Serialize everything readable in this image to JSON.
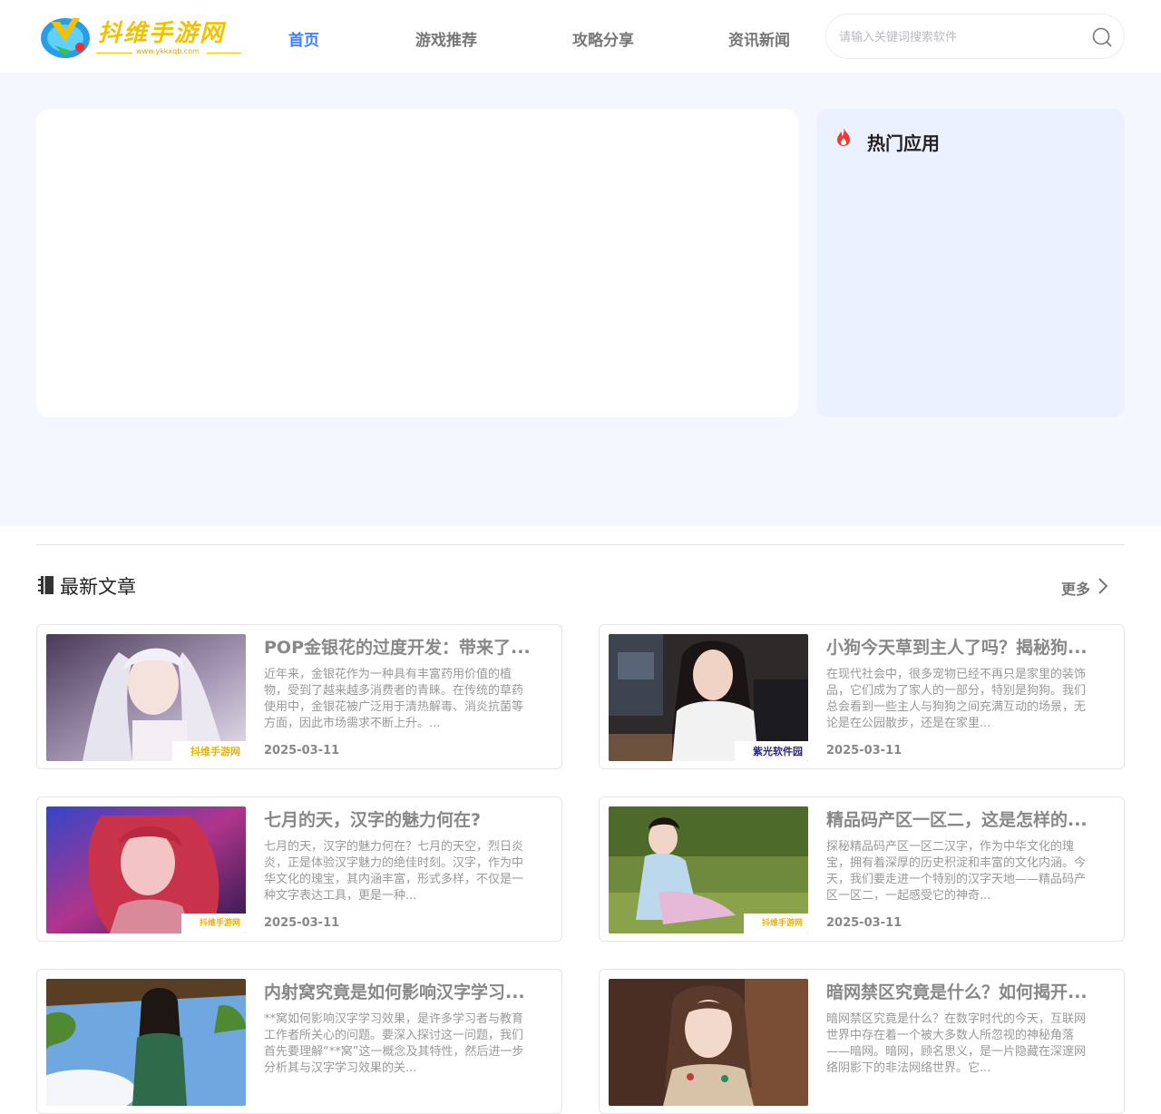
{
  "header": {
    "logo_text": "抖维手游网",
    "logo_url": "www.ykkxqb.com",
    "nav": [
      "首页",
      "游戏推荐",
      "攻略分享",
      "资讯新闻"
    ],
    "search_placeholder": "请输入关键词搜索软件"
  },
  "hot": {
    "title": "热门应用"
  },
  "latest": {
    "title": "最新文章",
    "more": "更多",
    "articles": [
      {
        "title": "POP金银花的过度开发：带来了...",
        "desc": "近年来，金银花作为一种具有丰富药用价值的植物，受到了越来越多消费者的青睐。在传统的草药使用中，金银花被广泛用于清热解毒、消炎抗菌等方面，因此市场需求不断上升。...",
        "date": "2025-03-11",
        "watermark": "抖维手游网"
      },
      {
        "title": "小狗今天草到主人了吗？揭秘狗...",
        "desc": "在现代社会中，很多宠物已经不再只是家里的装饰品，它们成为了家人的一部分，特别是狗狗。我们总会看到一些主人与狗狗之间充满互动的场景，无论是在公园散步，还是在家里...",
        "date": "2025-03-11",
        "watermark": "紫光软件园"
      },
      {
        "title": "七月的天，汉字的魅力何在?",
        "desc": "七月的天，汉字的魅力何在？七月的天空，烈日炎炎，正是体验汉字魅力的绝佳时刻。汉字，作为中华文化的瑰宝，其内涵丰富，形式多样，不仅是一种文字表达工具，更是一种...",
        "date": "2025-03-11",
        "watermark": "抖维手游网"
      },
      {
        "title": "精品码产区一区二，这是怎样的...",
        "desc": "探秘精品码产区一区二汉字，作为中华文化的瑰宝，拥有着深厚的历史积淀和丰富的文化内涵。今天，我们要走进一个特别的汉字天地——精品码产区一区二，一起感受它的神奇...",
        "date": "2025-03-11",
        "watermark": "抖维手游网"
      },
      {
        "title": "内射窝究竟是如何影响汉字学习...",
        "desc": "**窝如何影响汉字学习效果，是许多学习者与教育工作者所关心的问题。要深入探讨这一问题，我们首先要理解“**窝”这一概念及其特性，然后进一步分析其与汉字学习效果的关...",
        "date": "",
        "watermark": ""
      },
      {
        "title": "暗网禁区究竟是什么？如何揭开...",
        "desc": "暗网禁区究竟是什么？在数字时代的今天，互联网世界中存在着一个被大多数人所忽视的神秘角落——暗网。暗网，顾名思义，是一片隐藏在深邃网络阴影下的非法网络世界。它...",
        "date": "",
        "watermark": ""
      }
    ]
  },
  "colors": {
    "accent": "#3b82f6",
    "band_bg": "#f4f7fd",
    "hot_bg": "#ebf1fe",
    "logo_yellow": "#f2c200"
  },
  "icons": [
    "search-icon",
    "fire-icon",
    "book-icon",
    "chevron-right-icon"
  ]
}
